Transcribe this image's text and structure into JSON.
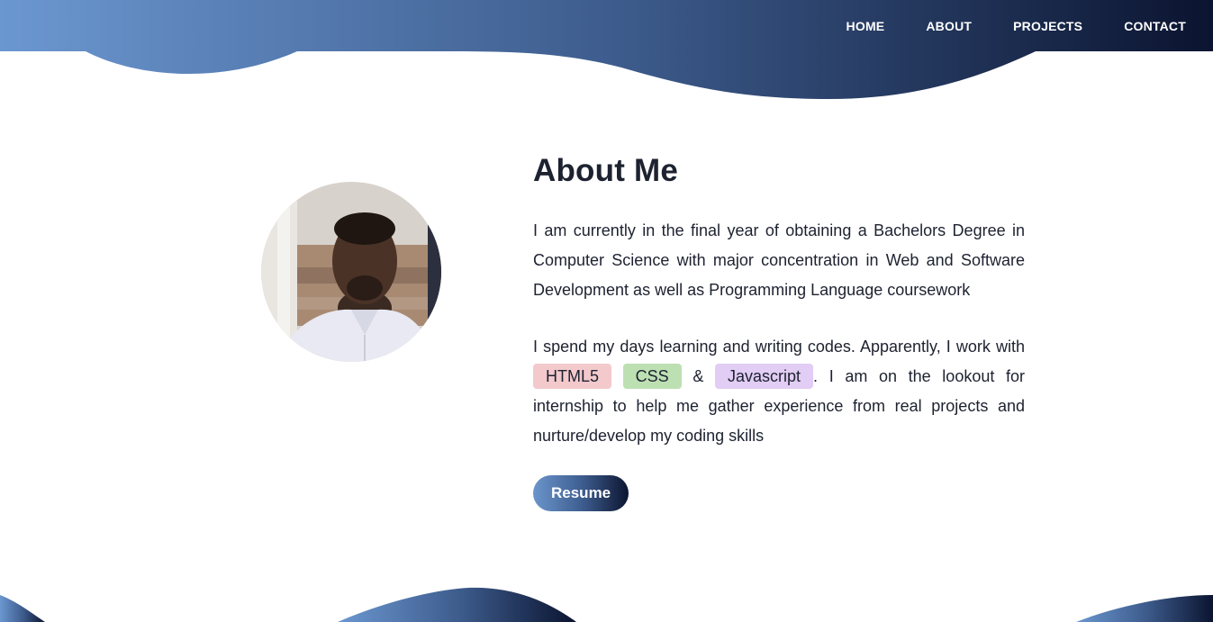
{
  "nav": {
    "items": [
      {
        "label": "HOME"
      },
      {
        "label": "ABOUT"
      },
      {
        "label": "PROJECTS"
      },
      {
        "label": "CONTACT"
      }
    ]
  },
  "about": {
    "title": "About Me",
    "paragraph1": "I am currently in the final year of obtaining a Bachelors Degree in Computer Science with major concentration in Web and Software Development as well as Programming Language coursework",
    "paragraph2_intro": "I spend my days learning and writing codes. Apparently, I work with",
    "tags": {
      "html": "HTML5",
      "css": "CSS",
      "ampersand": "&",
      "js": "Javascript"
    },
    "paragraph2_outro": ". I am on the lookout for internship to help me gather experience from real projects and nurture/develop my coding skills",
    "resume_label": "Resume"
  },
  "colors": {
    "gradient_start": "#6b95cb",
    "gradient_end": "#0c1530",
    "text": "#1d2230"
  }
}
